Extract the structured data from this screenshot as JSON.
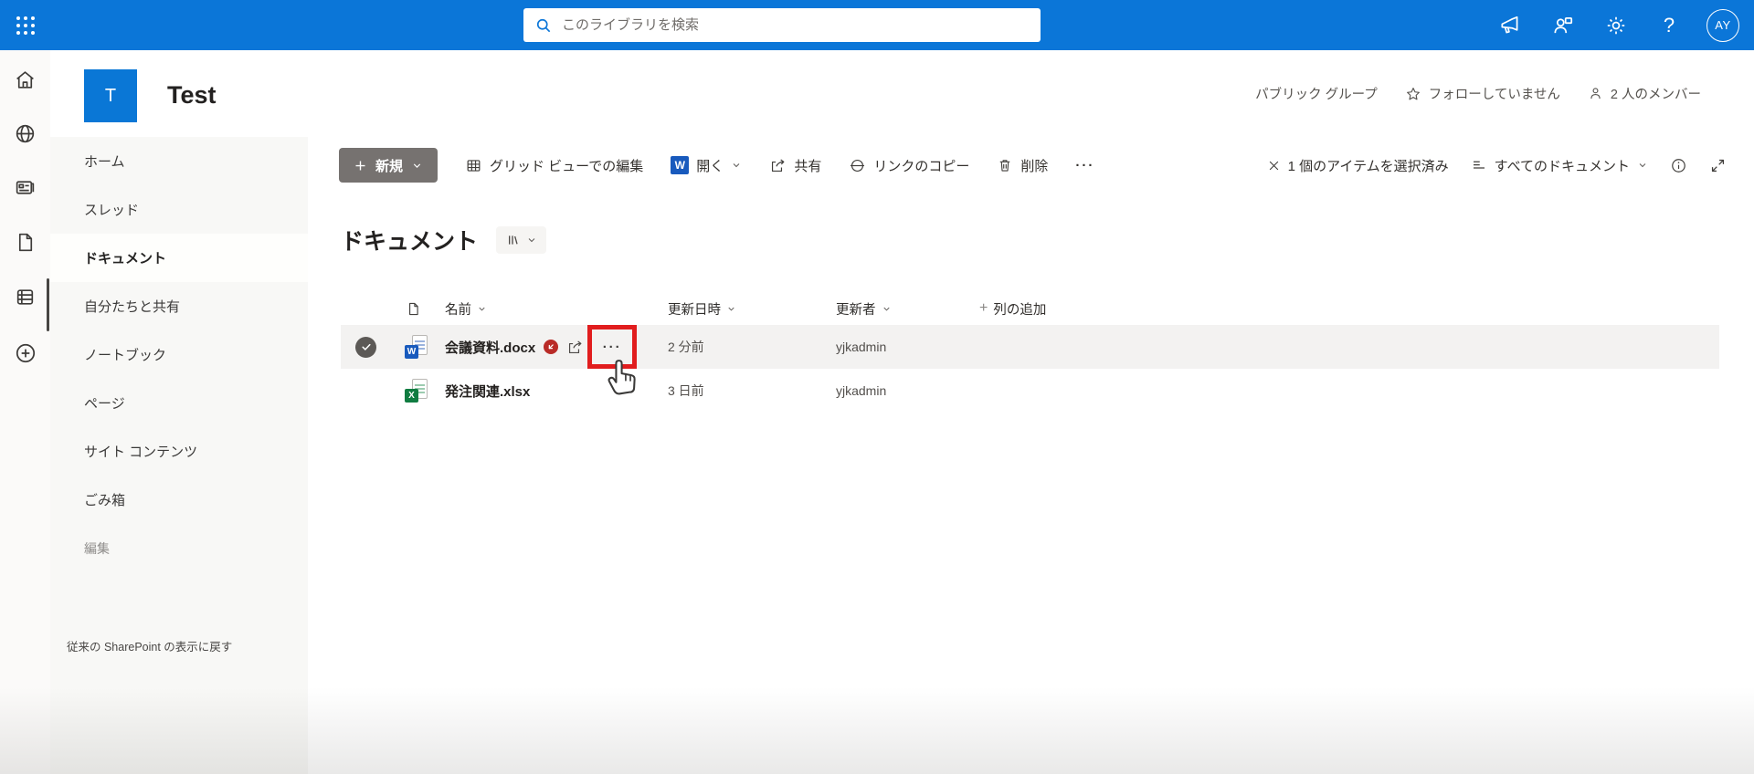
{
  "suite_bar": {
    "search_placeholder": "このライブラリを検索",
    "avatar_initials": "AY"
  },
  "site": {
    "logo_letter": "T",
    "title": "Test",
    "privacy_label": "パブリック グループ",
    "follow_label": "フォローしていません",
    "members_label": "2 人のメンバー"
  },
  "toolbar": {
    "new_label": "新規",
    "grid_edit_label": "グリッド ビューでの編集",
    "open_label": "開く",
    "share_label": "共有",
    "copy_link_label": "リンクのコピー",
    "delete_label": "削除",
    "more_label": "···",
    "selected_count_label": "1 個のアイテムを選択済み",
    "view_label": "すべてのドキュメント"
  },
  "sidebar": {
    "items": [
      "ホーム",
      "スレッド",
      "ドキュメント",
      "自分たちと共有",
      "ノートブック",
      "ページ",
      "サイト コンテンツ",
      "ごみ箱",
      "編集"
    ],
    "footer_link": "従来の SharePoint の表示に戻す"
  },
  "main": {
    "heading": "ドキュメント",
    "table": {
      "columns": {
        "name": "名前",
        "modified": "更新日時",
        "modified_by": "更新者",
        "add_column": "列の追加"
      },
      "rows": [
        {
          "name": "会議資料.docx",
          "type": "word",
          "modified": "2 分前",
          "modified_by": "yjkadmin",
          "more_label": "···",
          "selected": true
        },
        {
          "name": "発注関連.xlsx",
          "type": "excel",
          "modified": "3 日前",
          "modified_by": "yjkadmin",
          "selected": false
        }
      ]
    }
  },
  "colors": {
    "suite_bar_blue": "#0b76d8",
    "annotation_red": "#e11d1e",
    "word_blue": "#185abd",
    "excel_green": "#107c41",
    "restricted_red": "#b92b27",
    "selected_row_gray": "#f3f2f1"
  }
}
